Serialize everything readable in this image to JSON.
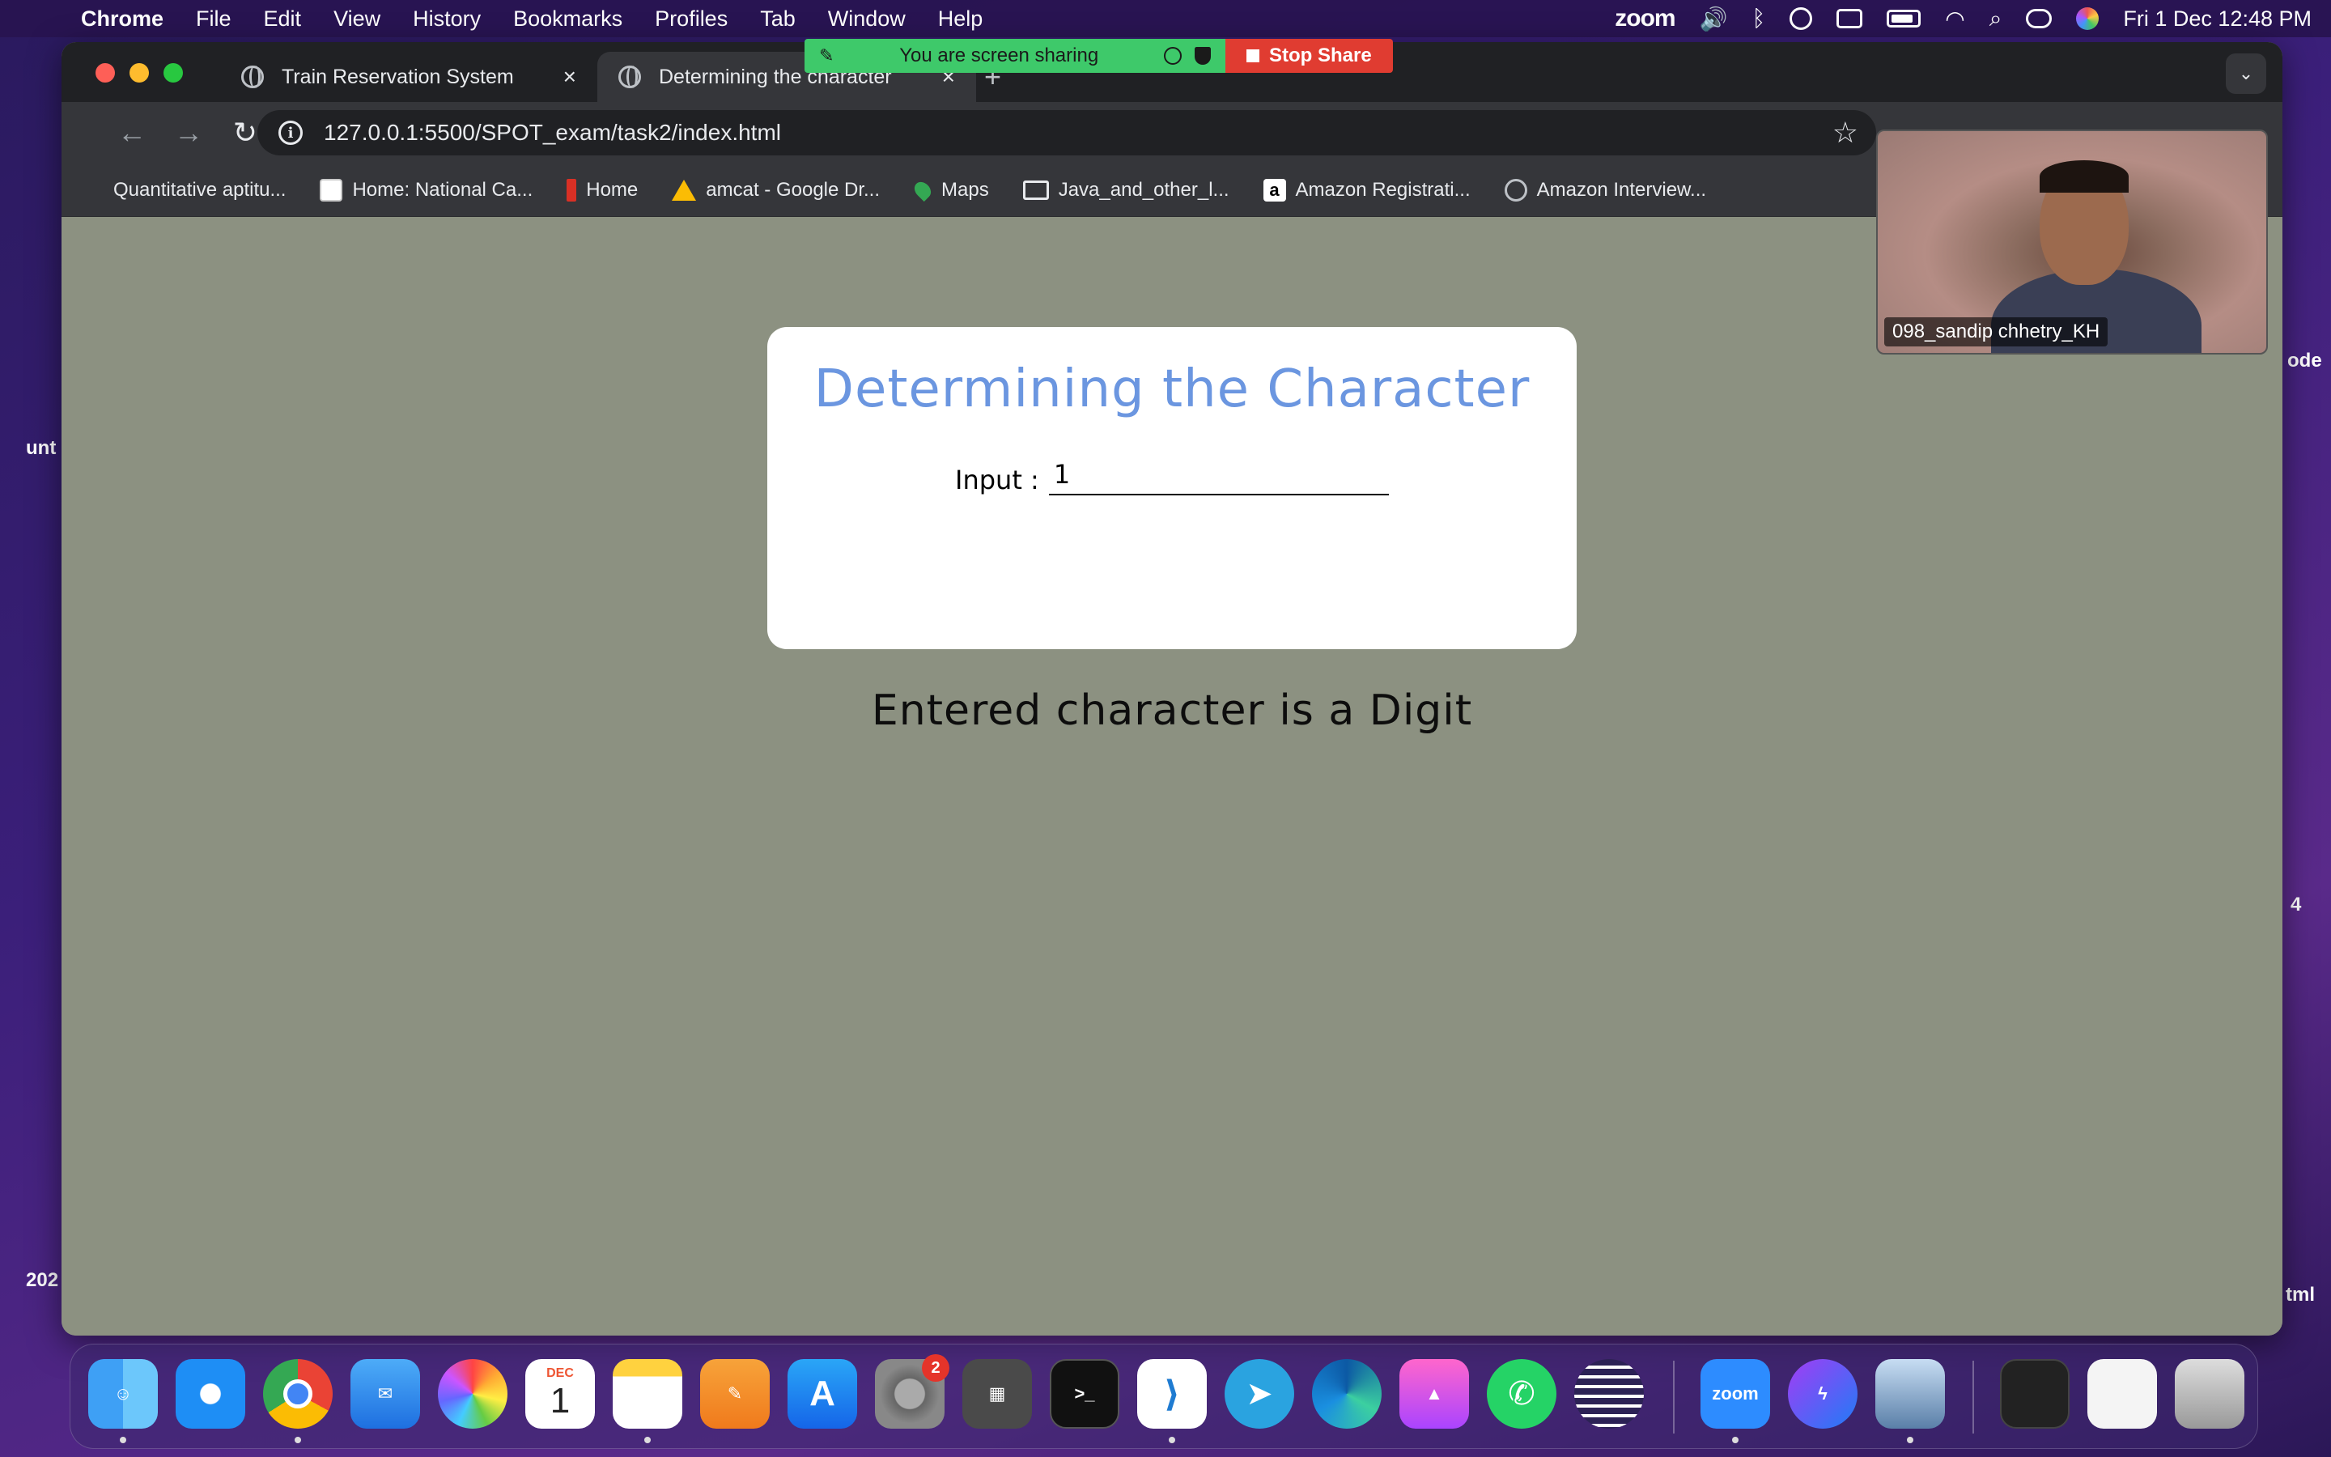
{
  "menubar": {
    "app": "Chrome",
    "menus": [
      "File",
      "Edit",
      "View",
      "History",
      "Bookmarks",
      "Profiles",
      "Tab",
      "Window",
      "Help"
    ],
    "zoom_label": "zoom",
    "clock": "Fri 1 Dec  12:48 PM"
  },
  "desktop": {
    "left_label_1": "unt",
    "left_label_2": "202",
    "right_label_1": "ode",
    "right_label_2": "4",
    "right_label_3": "tml"
  },
  "tabs": [
    {
      "title": "Train Reservation System",
      "close": "×"
    },
    {
      "title": "Determining the character",
      "close": "×"
    }
  ],
  "new_tab": "+",
  "address_bar": {
    "url": "127.0.0.1:5500/SPOT_exam/task2/index.html"
  },
  "bookmarks": [
    {
      "label": "Quantitative aptitu...",
      "icon": "none"
    },
    {
      "label": "Home: National Ca...",
      "icon": "national-careers-icon"
    },
    {
      "label": "Home",
      "icon": "red-bar-icon"
    },
    {
      "label": "amcat - Google Dr...",
      "icon": "google-drive-icon"
    },
    {
      "label": "Maps",
      "icon": "maps-icon"
    },
    {
      "label": "Java_and_other_l...",
      "icon": "folder-icon"
    },
    {
      "label": "Amazon Registrati...",
      "icon": "amazon-icon"
    },
    {
      "label": "Amazon Interview...",
      "icon": "globe-icon"
    }
  ],
  "page": {
    "heading": "Determining the Character",
    "input_label": "Input :",
    "input_value": "1",
    "result": "Entered character is a Digit",
    "heading_color": "#6b96e0",
    "background_color": "#8c9181"
  },
  "screen_share": {
    "message": "You are screen sharing",
    "stop_label": "Stop Share"
  },
  "video": {
    "participant_name": "098_sandip chhetry_KH"
  },
  "dock": {
    "calendar_month": "DEC",
    "calendar_day": "1",
    "settings_badge": "2",
    "zoom_label": "zoom",
    "terminal_prompt": ">_"
  }
}
